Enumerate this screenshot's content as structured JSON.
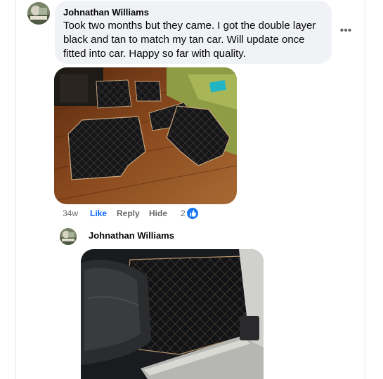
{
  "comment": {
    "author": "Johnathan Williams",
    "text": "Took two months but they came. I got the double layer black and tan to match my tan car. Will update once fitted into car. Happy so far with quality.",
    "more_icon": "more-horizontal-icon",
    "image_description": "car floor mats laid out on wood floor"
  },
  "actions": {
    "time": "34w",
    "like": "Like",
    "reply": "Reply",
    "hide": "Hide",
    "reaction_count": "2",
    "reaction_icon": "like-icon"
  },
  "reply": {
    "author": "Johnathan Williams",
    "image_description": "floor mat fitted in car"
  },
  "colors": {
    "bubble": "#f0f2f5",
    "like_blue": "#0866ff",
    "muted": "#65676b"
  }
}
